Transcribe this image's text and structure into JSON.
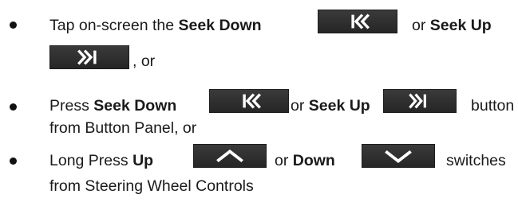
{
  "items": [
    {
      "line1_prefix": "Tap on-screen the ",
      "line1_b1": "Seek Down",
      "line1_mid": " or ",
      "line1_b2": "Seek Up",
      "line2_suffix": " , or",
      "icons": [
        "seek-down-icon",
        "seek-up-icon"
      ]
    },
    {
      "line1_prefix": "Press ",
      "line1_b1": "Seek Down",
      "line1_mid": " or ",
      "line1_b2": "Seek Up",
      "line1_right": "button",
      "line2": "from Button Panel, or",
      "icons": [
        "seek-down-icon",
        "seek-up-icon"
      ]
    },
    {
      "line1_prefix": "Long Press ",
      "line1_b1": "Up",
      "line1_mid": " or ",
      "line1_b2": "Down",
      "line1_right": "switches",
      "line2": "from Steering Wheel Controls",
      "icons": [
        "up-arrow-icon",
        "down-arrow-icon"
      ]
    }
  ],
  "colors": {
    "button_bg": "#2e2e2e",
    "icon_glyph": "#ffffff",
    "text": "#1a1a1a"
  }
}
